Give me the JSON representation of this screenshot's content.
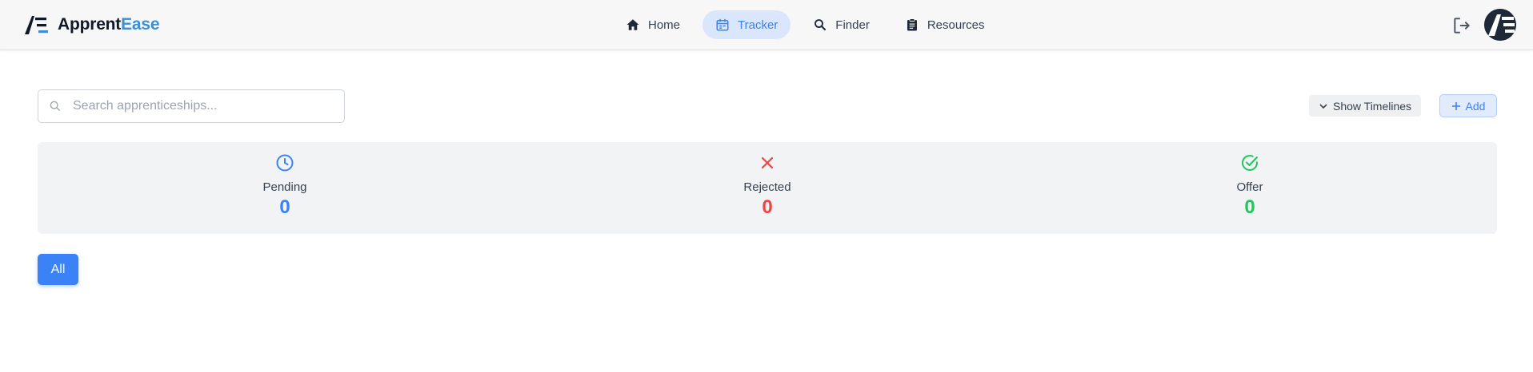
{
  "brand": {
    "name_part1": "Apprent",
    "name_part2": "Ease",
    "accent": "#3b8fd6"
  },
  "nav": {
    "items": [
      {
        "label": "Home",
        "icon": "home-icon",
        "active": false
      },
      {
        "label": "Tracker",
        "icon": "calendar-icon",
        "active": true
      },
      {
        "label": "Finder",
        "icon": "search-icon",
        "active": false
      },
      {
        "label": "Resources",
        "icon": "clipboard-icon",
        "active": false
      }
    ]
  },
  "header_actions": {
    "logout_icon": "logout-icon",
    "avatar": "user-avatar"
  },
  "search": {
    "placeholder": "Search apprenticeships...",
    "value": ""
  },
  "toolbar": {
    "timelines_label": "Show Timelines",
    "add_label": "Add"
  },
  "stats": [
    {
      "label": "Pending",
      "value": "0",
      "color": "#3b82f6",
      "icon": "clock-icon"
    },
    {
      "label": "Rejected",
      "value": "0",
      "color": "#ef4444",
      "icon": "x-icon"
    },
    {
      "label": "Offer",
      "value": "0",
      "color": "#22c55e",
      "icon": "check-circle-icon"
    }
  ],
  "filters": {
    "all_label": "All"
  },
  "colors": {
    "primary": "#3b82f6",
    "active_nav_bg": "#d9e6fb"
  }
}
